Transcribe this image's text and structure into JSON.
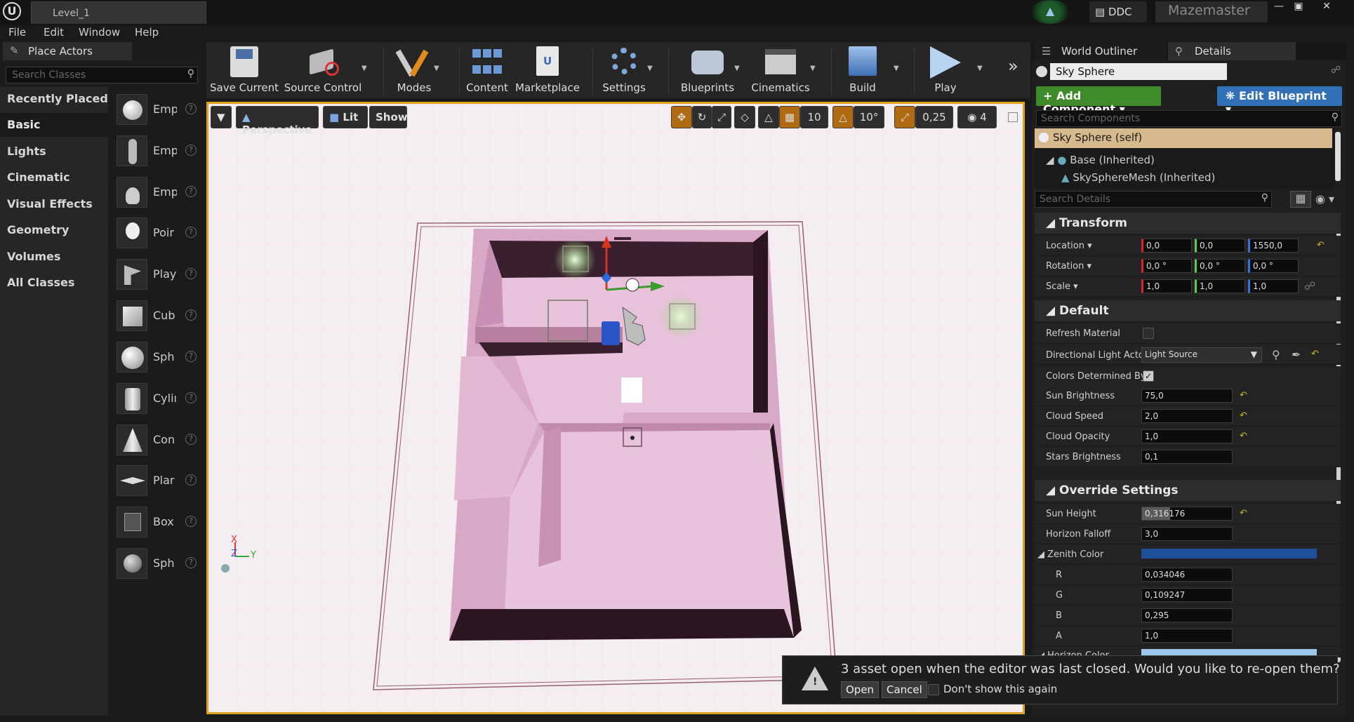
{
  "titlebar": {
    "document_tab": "Level_1",
    "ddc": "DDC",
    "project": "Mazemaster",
    "window_buttons": [
      "—",
      "▣",
      "✕"
    ]
  },
  "menu": [
    "File",
    "Edit",
    "Window",
    "Help"
  ],
  "place_actors": {
    "tab": "Place Actors",
    "search_placeholder": "Search Classes",
    "categories": [
      "Recently Placed",
      "Basic",
      "Lights",
      "Cinematic",
      "Visual Effects",
      "Geometry",
      "Volumes",
      "All Classes"
    ],
    "selected_category": "Basic",
    "items": [
      "Emp",
      "Emp",
      "Emp",
      "Poir",
      "Play",
      "Cub",
      "Sph",
      "Cyliı",
      "Con",
      "Plar",
      "Box",
      "Sph"
    ]
  },
  "toolbar": {
    "buttons": [
      "Save Current",
      "Source Control",
      "Modes",
      "Content",
      "Marketplace",
      "Settings",
      "Blueprints",
      "Cinematics",
      "Build",
      "Play"
    ],
    "overflow": "»"
  },
  "viewport": {
    "perspective": "Perspective",
    "lit": "Lit",
    "show": "Show",
    "grid_snap": "10",
    "rot_snap": "10°",
    "scale_snap": "0,25",
    "cam_speed": "4",
    "axis_x": "X",
    "axis_y": "Y",
    "axis_z": "Z"
  },
  "right_panel": {
    "tabs": [
      "World Outliner",
      "Details"
    ],
    "object_name": "Sky Sphere",
    "add_component": "+ Add Component ▾",
    "edit_blueprint": "Edit Blueprint ▾",
    "search_components": "Search Components",
    "components": {
      "self": "Sky Sphere (self)",
      "base": "Base (Inherited)",
      "mesh": "SkySphereMesh (Inherited)"
    },
    "search_details": "Search Details",
    "transform": {
      "title": "Transform",
      "location_label": "Location ▾",
      "location": [
        "0,0",
        "0,0",
        "1550,0"
      ],
      "rotation_label": "Rotation ▾",
      "rotation": [
        "0,0 °",
        "0,0 °",
        "0,0 °"
      ],
      "scale_label": "Scale ▾",
      "scale": [
        "1,0",
        "1,0",
        "1,0"
      ]
    },
    "default": {
      "title": "Default",
      "refresh_material": "Refresh Material",
      "directional_light_actor": "Directional Light Actor",
      "directional_light_value": "Light Source",
      "colors_determined_by": "Colors Determined By",
      "sun_brightness": "Sun Brightness",
      "sun_brightness_value": "75,0",
      "cloud_speed": "Cloud Speed",
      "cloud_speed_value": "2,0",
      "cloud_opacity": "Cloud Opacity",
      "cloud_opacity_value": "1,0",
      "stars_brightness": "Stars Brightness",
      "stars_brightness_value": "0,1"
    },
    "override": {
      "title": "Override Settings",
      "sun_height": "Sun Height",
      "sun_height_value": "0,316176",
      "sun_height_fraction": 0.316176,
      "horizon_falloff": "Horizon Falloff",
      "horizon_falloff_value": "3,0",
      "zenith_color": "Zenith Color",
      "zenith_color_hex": "#1f4f9a",
      "r_label": "R",
      "r_value": "0,034046",
      "g_label": "G",
      "g_value": "0,109247",
      "b_label": "B",
      "b_value": "0,295",
      "a_label": "A",
      "a_value": "1,0",
      "horizon_color": "Horizon Color"
    }
  },
  "notification": {
    "message": "3 asset  open when the editor was last closed. Would you like to re-open them?",
    "open": "Open",
    "cancel": "Cancel",
    "dont_show": "Don't show this again"
  }
}
